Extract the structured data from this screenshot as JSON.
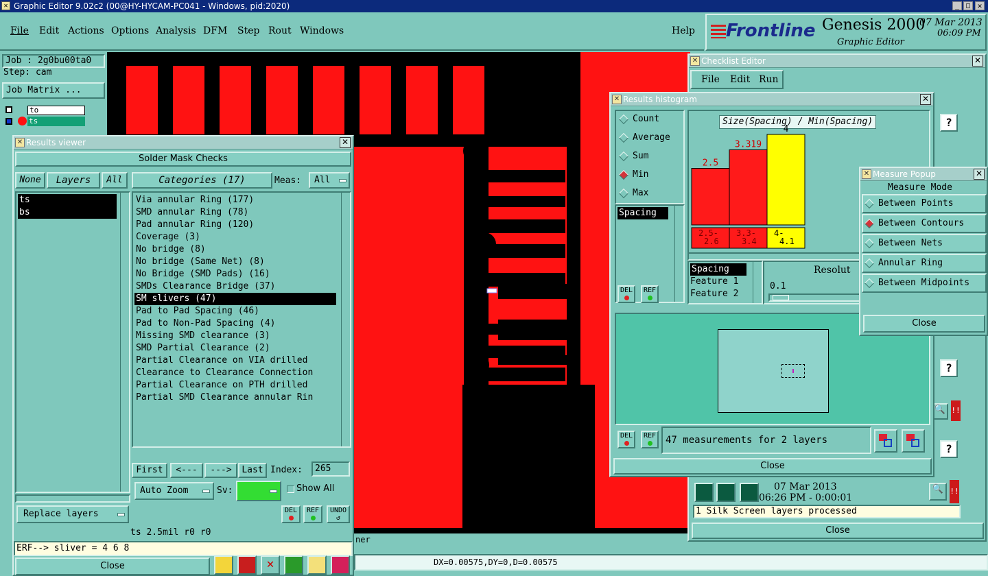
{
  "window": {
    "title": "Graphic Editor 9.02c2 (00@HY-HYCAM-PC041 - Windows, pid:2020)"
  },
  "menu": {
    "items": [
      "File",
      "Edit",
      "Actions",
      "Options",
      "Analysis",
      "DFM",
      "Step",
      "Rout",
      "Windows"
    ],
    "help": "Help"
  },
  "brand": {
    "logo": "Frontline",
    "product": "Genesis 2000",
    "subtitle": "Graphic Editor",
    "date": "07 Mar 2013",
    "time": "06:09 PM"
  },
  "job": {
    "job_label": "Job : 2g0bu00ta0",
    "step_label": "Step: cam",
    "matrix_button": "Job Matrix ...",
    "layer_rows": [
      "to",
      "ts"
    ]
  },
  "results_viewer": {
    "title": "Results viewer",
    "header": "Solder Mask Checks",
    "none_btn": "None",
    "layers_btn": "Layers",
    "all_btn": "All",
    "layers": [
      "ts",
      "bs"
    ],
    "categories_btn": "Categories (17)",
    "meas_label": "Meas:",
    "meas_value": "All",
    "categories": [
      "Via annular Ring (177)",
      "SMD annular Ring (78)",
      "Pad annular Ring (120)",
      "Coverage (3)",
      "No bridge (8)",
      "No bridge (Same Net) (8)",
      "No Bridge (SMD Pads) (16)",
      "SMDs Clearance Bridge (37)",
      "SM slivers (47)",
      "Pad to Pad Spacing (46)",
      "Pad to Non-Pad Spacing (4)",
      "Missing SMD clearance (3)",
      "SMD Partial Clearance (2)",
      "Partial Clearance on VIA drilled",
      "Clearance to Clearance Connection",
      "Partial Clearance on PTH drilled",
      "Partial SMD Clearance annular Rin"
    ],
    "selected_index": 8,
    "nav": {
      "first": "First",
      "prev": "<---",
      "next": "--->",
      "last": "Last",
      "index_label": "Index:",
      "index_value": "265"
    },
    "auto_zoom": "Auto Zoom",
    "sv_label": "Sv:",
    "show_all": "Show All",
    "replace_layers": "Replace layers",
    "del": "DEL",
    "ref": "REF",
    "undo": "UNDO",
    "status": "ts 2.5mil  r0  r0",
    "erf": "ERF--> sliver = 4 6 8",
    "close": "Close"
  },
  "histogram": {
    "title": "Results histogram",
    "modes": [
      "Count",
      "Average",
      "Sum",
      "Min",
      "Max"
    ],
    "selected_mode": "Min",
    "chart_title": "Size(Spacing) / Min(Spacing)",
    "list_item": "Spacing",
    "features": [
      "Spacing",
      "Feature 1",
      "Feature 2"
    ],
    "resolution_label": "Resolut",
    "resolution_value": "0.1",
    "measurements": "47 measurements for 2 layers",
    "del": "DEL",
    "ref": "REF",
    "close": "Close"
  },
  "chart_data": {
    "type": "bar",
    "title": "Size(Spacing) / Min(Spacing)",
    "categories": [
      "2.5-\n2.6",
      "3.3-\n3.4",
      "4-\n4.1"
    ],
    "values": [
      2.5,
      3.319,
      4
    ],
    "value_labels": [
      "2.5",
      "3.319",
      "4"
    ],
    "colors": [
      "#ff1a1a",
      "#ff1a1a",
      "#ffff00"
    ],
    "label_colors": [
      "#cc0000",
      "#cc0000",
      "#000000"
    ],
    "ylim": [
      0,
      4.6
    ]
  },
  "checklist": {
    "title": "Checklist Editor",
    "menu": [
      "File",
      "Edit",
      "Run"
    ],
    "date": "07 Mar 2013",
    "time_line": "06:26 PM - 0:00:01",
    "status": "1 Silk Screen layers processed",
    "close": "Close"
  },
  "measure": {
    "title": "Measure Popup",
    "header": "Measure Mode",
    "modes": [
      "Between Points",
      "Between Contours",
      "Between Nets",
      "Annular Ring",
      "Between Midpoints"
    ],
    "selected": "Between Contours",
    "close": "Close"
  },
  "bottom": {
    "coords": "DX=0.00575,DY=0,D=0.00575",
    "partial": "ner"
  },
  "colors": {
    "bg": "#7fc8bc",
    "copper": "#ff1212",
    "accent_green": "#33dd33"
  }
}
